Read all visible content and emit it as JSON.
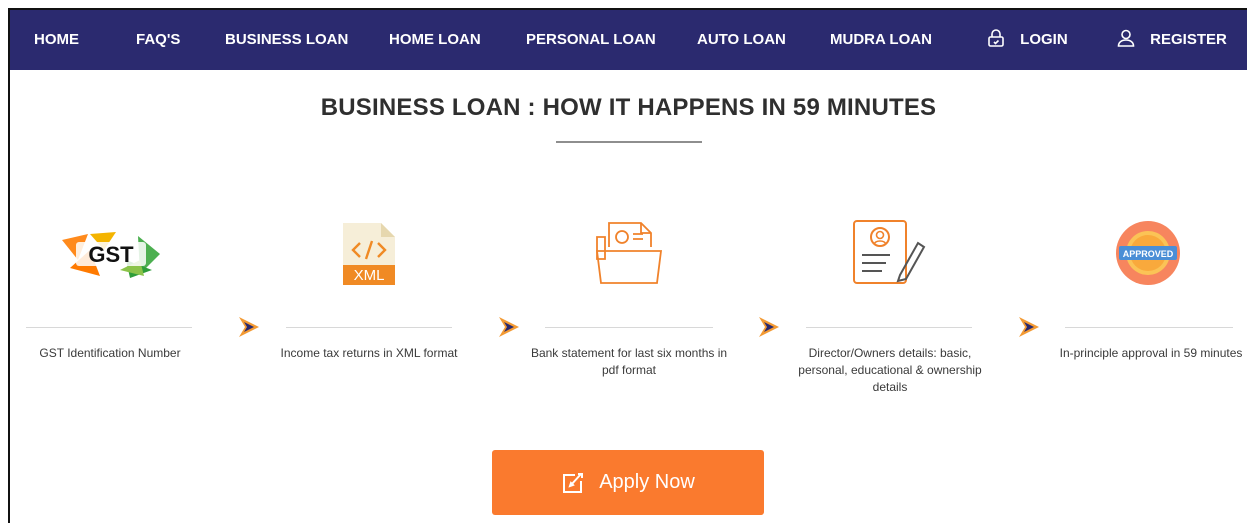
{
  "nav": {
    "home": "HOME",
    "faqs": "FAQ'S",
    "business_loan": "BUSINESS LOAN",
    "home_loan": "HOME LOAN",
    "personal_loan": "PERSONAL LOAN",
    "auto_loan": "AUTO LOAN",
    "mudra_loan": "MUDRA LOAN",
    "login": "LOGIN",
    "register": "REGISTER"
  },
  "title": "BUSINESS LOAN : HOW IT HAPPENS IN 59 MINUTES",
  "steps": [
    {
      "text": "GST Identification Number",
      "icon": "gst-logo",
      "logo_text": "GST"
    },
    {
      "text": "Income tax returns in XML format",
      "icon": "xml-file-icon",
      "logo_text": "XML"
    },
    {
      "text": "Bank statement for last six months in pdf format",
      "icon": "bank-statement-folder-icon"
    },
    {
      "text": "Director/Owners details: basic, personal, educational & ownership details",
      "icon": "director-profile-document-icon"
    },
    {
      "text": "In-principle approval in 59 minutes",
      "icon": "approved-badge-icon",
      "logo_text": "APPROVED"
    }
  ],
  "apply_button": "Apply Now",
  "colors": {
    "nav_bg": "#2b2a6f",
    "accent_orange": "#fa7a2e",
    "arrow_blue": "#2b2a6f"
  }
}
